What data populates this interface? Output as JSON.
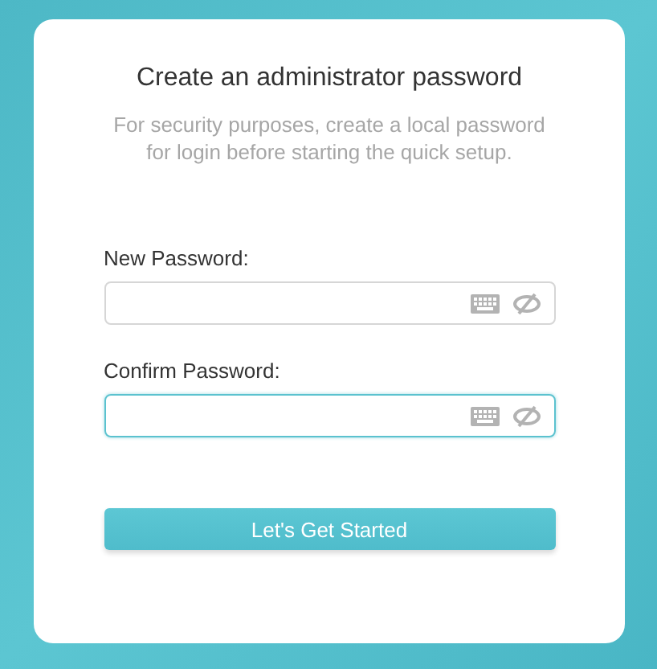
{
  "title": "Create an administrator password",
  "description": "For security purposes, create a local password for login before starting the quick setup.",
  "fields": [
    {
      "label": "New Password:",
      "focused": false
    },
    {
      "label": "Confirm Password:",
      "focused": true
    }
  ],
  "button": "Let's Get Started"
}
